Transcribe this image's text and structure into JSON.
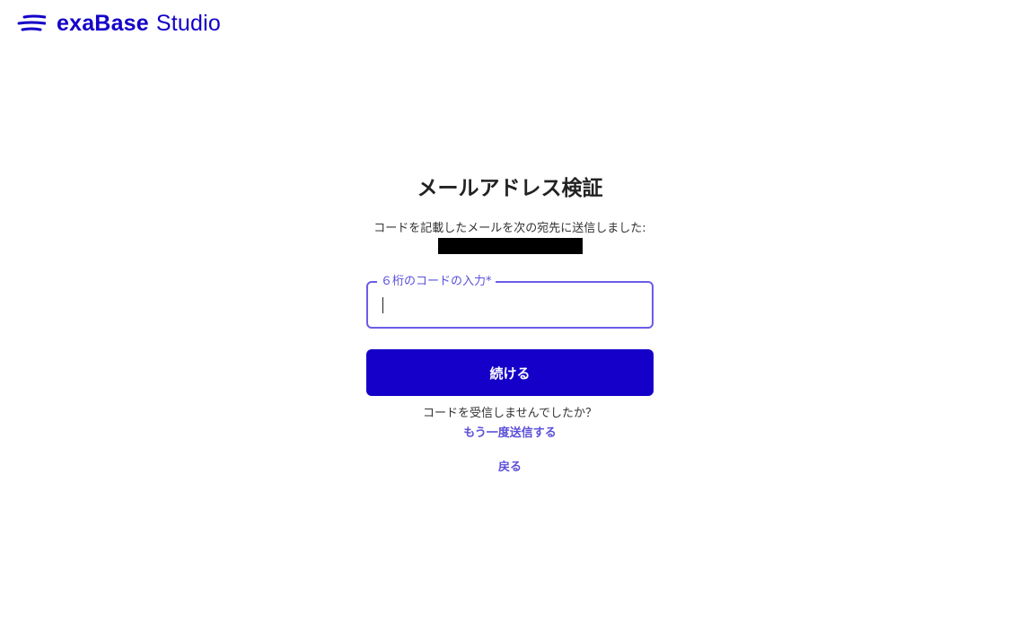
{
  "header": {
    "logo_icon": "exabase-wave-logo",
    "brand_bold": "exaBase",
    "brand_light": "Studio",
    "brand_color": "#1400c8"
  },
  "verify": {
    "title": "メールアドレス検証",
    "description_prefix": "コードを記載したメールを次の宛先に送信しました:",
    "code_field": {
      "label": "６桁のコードの入力*",
      "value": "",
      "placeholder": ""
    },
    "continue_label": "続ける",
    "resend_question": "コードを受信しませんでしたか？",
    "resend_link": "もう一度送信する",
    "back_link": "戻る"
  },
  "colors": {
    "primary": "#1400c8",
    "link": "#5b4fd9",
    "field_border": "#6b5ce8"
  }
}
